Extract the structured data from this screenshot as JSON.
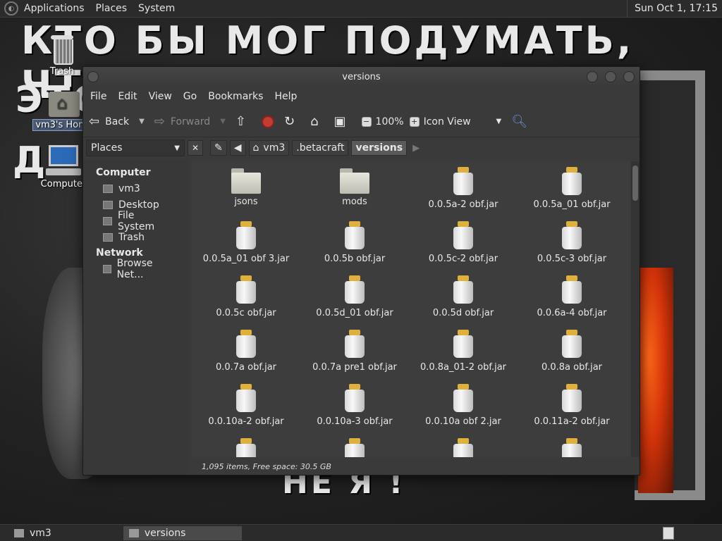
{
  "top_panel": {
    "menus": [
      "Applications",
      "Places",
      "System"
    ],
    "clock": "Sun Oct  1, 17:15"
  },
  "wallpaper": {
    "line1": "КТО БЫ МОГ ПОДУМАТЬ, ЧТО Я -",
    "line2": "ЭТО",
    "line3": "Д",
    "line4": "НЕ Я !"
  },
  "desktop": {
    "trash_label": "Trash",
    "home_label": "vm3's Home",
    "computer_label": "Computer"
  },
  "window": {
    "title": "versions",
    "menu": [
      "File",
      "Edit",
      "View",
      "Go",
      "Bookmarks",
      "Help"
    ],
    "toolbar": {
      "back": "Back",
      "forward": "Forward",
      "zoom": "100%",
      "view_mode": "Icon View"
    },
    "location": {
      "places_label": "Places",
      "crumbs": [
        "vm3",
        ".betacraft",
        "versions"
      ]
    },
    "sidebar": {
      "computer_header": "Computer",
      "computer_items": [
        "vm3",
        "Desktop",
        "File System",
        "Trash"
      ],
      "network_header": "Network",
      "network_items": [
        "Browse Net..."
      ]
    },
    "items": [
      {
        "name": "jsons",
        "type": "folder"
      },
      {
        "name": "mods",
        "type": "folder"
      },
      {
        "name": "0.0.5a-2 obf.jar",
        "type": "jar"
      },
      {
        "name": "0.0.5a_01 obf.jar",
        "type": "jar"
      },
      {
        "name": "0.0.5a_01 obf 3.jar",
        "type": "jar"
      },
      {
        "name": "0.0.5b obf.jar",
        "type": "jar"
      },
      {
        "name": "0.0.5c-2 obf.jar",
        "type": "jar"
      },
      {
        "name": "0.0.5c-3 obf.jar",
        "type": "jar"
      },
      {
        "name": "0.0.5c obf.jar",
        "type": "jar"
      },
      {
        "name": "0.0.5d_01 obf.jar",
        "type": "jar"
      },
      {
        "name": "0.0.5d obf.jar",
        "type": "jar"
      },
      {
        "name": "0.0.6a-4 obf.jar",
        "type": "jar"
      },
      {
        "name": "0.0.7a obf.jar",
        "type": "jar"
      },
      {
        "name": "0.0.7a pre1 obf.jar",
        "type": "jar"
      },
      {
        "name": "0.0.8a_01-2 obf.jar",
        "type": "jar"
      },
      {
        "name": "0.0.8a obf.jar",
        "type": "jar"
      },
      {
        "name": "0.0.10a-2 obf.jar",
        "type": "jar"
      },
      {
        "name": "0.0.10a-3 obf.jar",
        "type": "jar"
      },
      {
        "name": "0.0.10a obf 2.jar",
        "type": "jar"
      },
      {
        "name": "0.0.11a-2 obf.jar",
        "type": "jar"
      },
      {
        "name": "",
        "type": "jar"
      },
      {
        "name": "",
        "type": "jar"
      },
      {
        "name": "",
        "type": "jar"
      },
      {
        "name": "",
        "type": "jar"
      }
    ],
    "status": "1,095 items, Free space: 30.5 GB"
  },
  "bottom_panel": {
    "tasks": [
      "vm3",
      "versions"
    ]
  }
}
